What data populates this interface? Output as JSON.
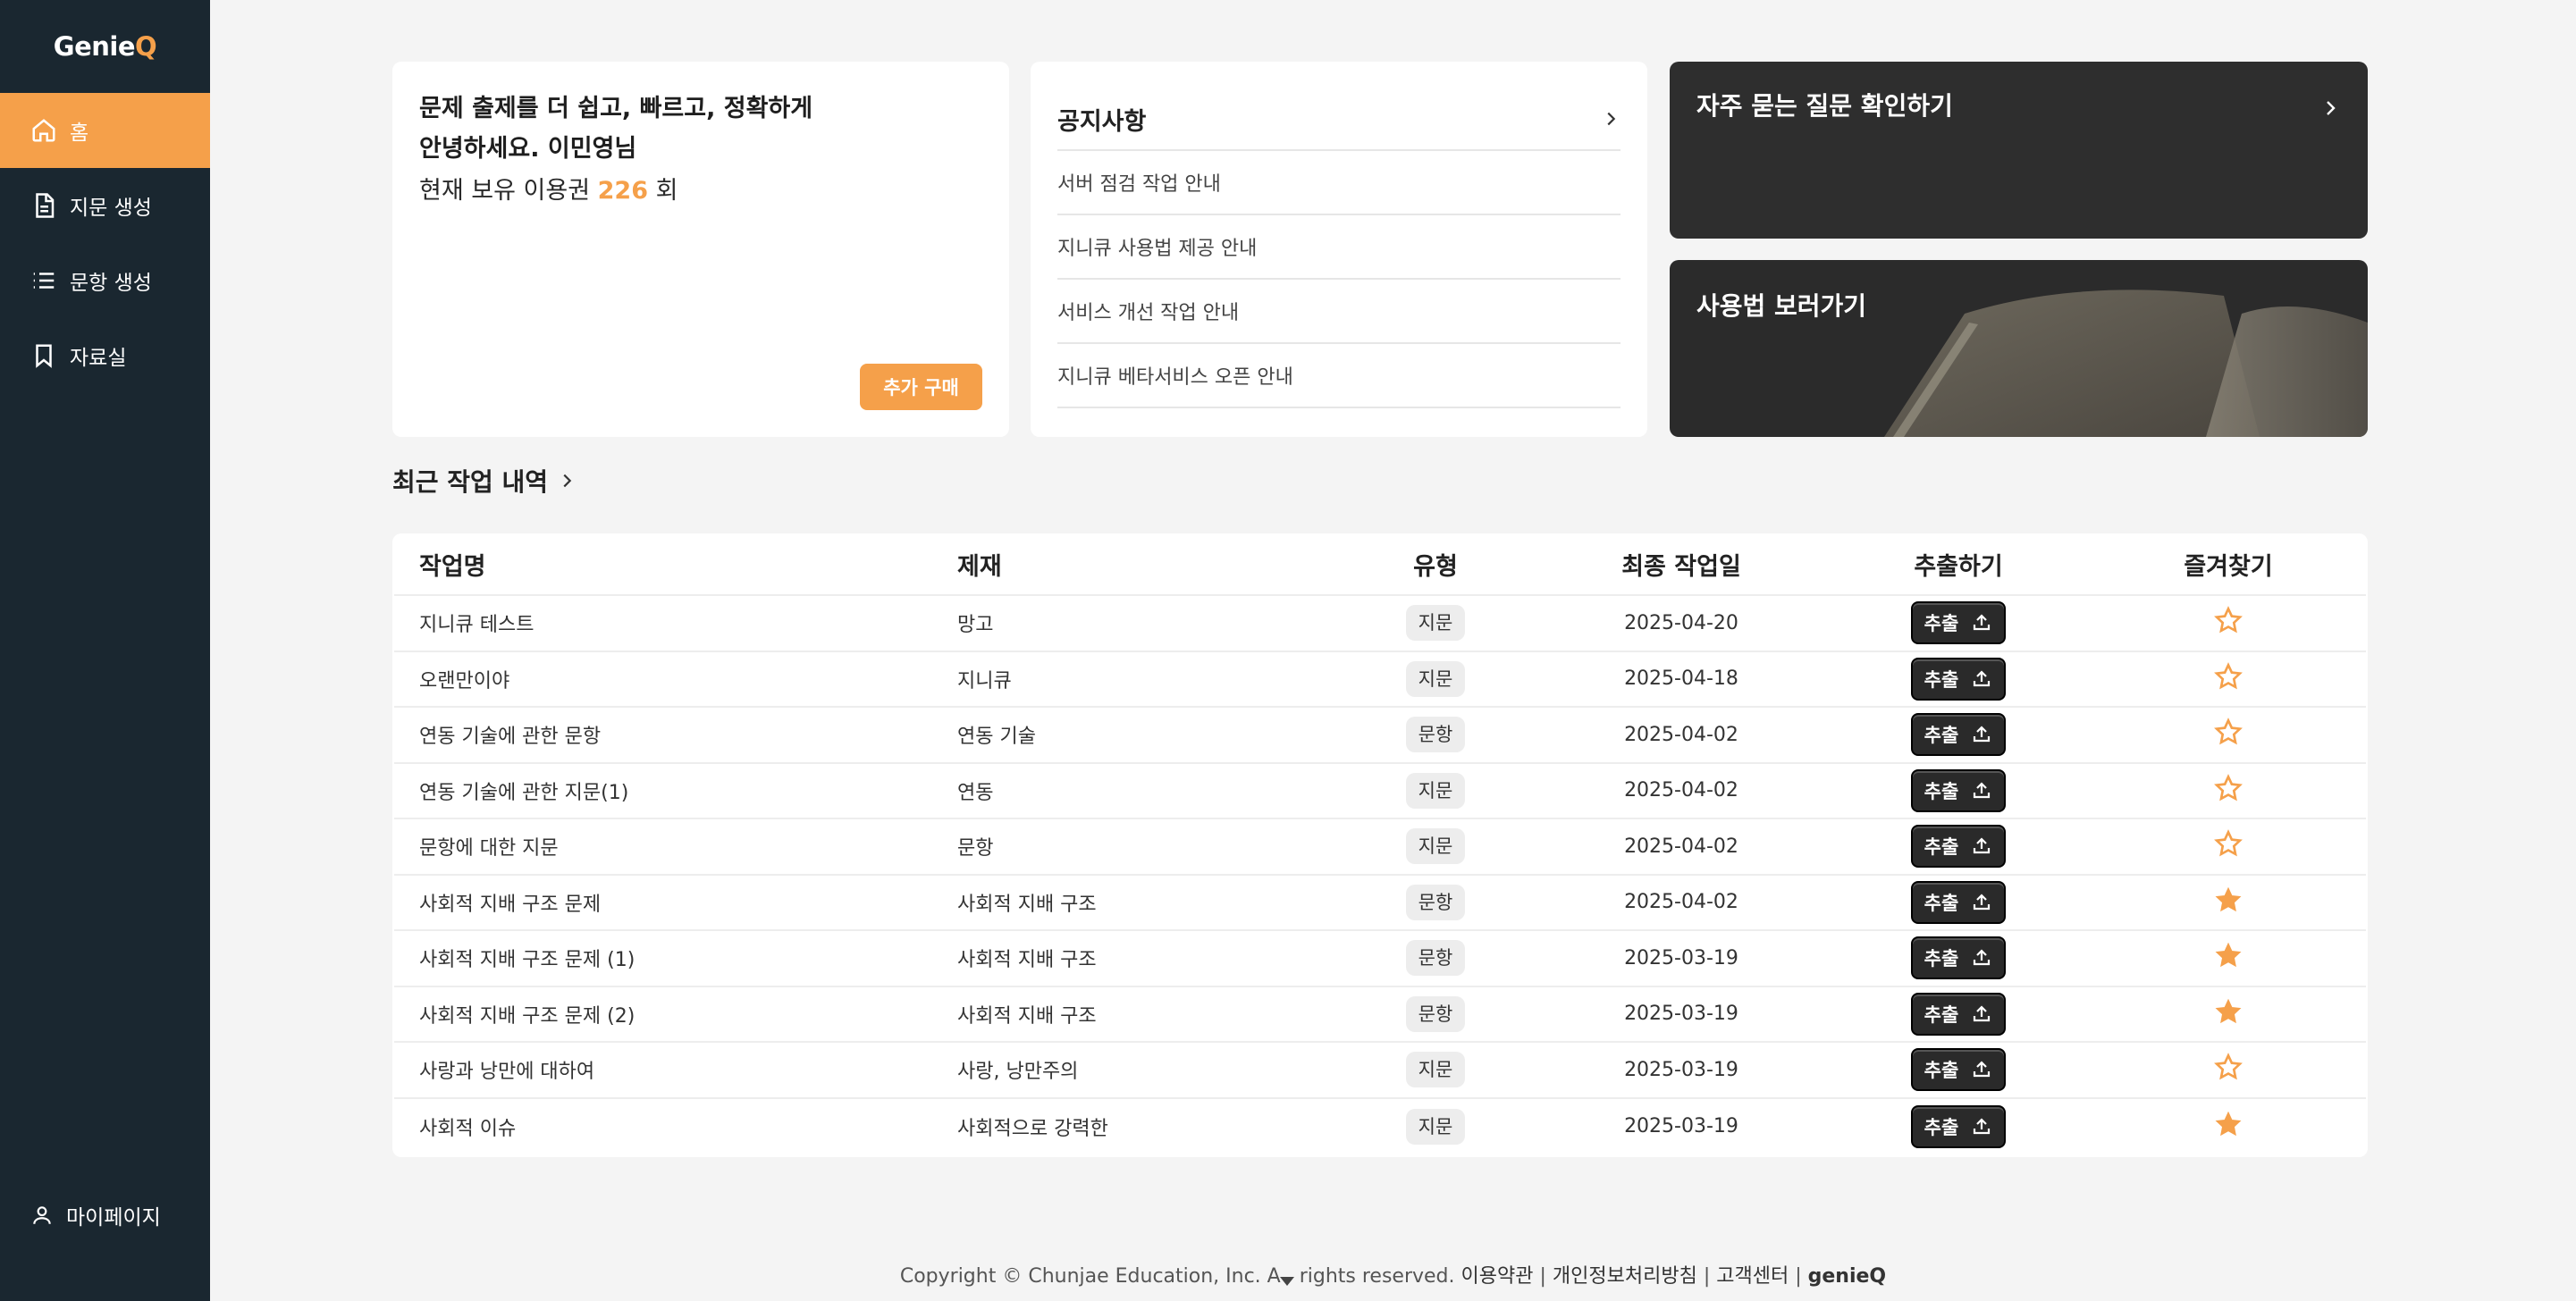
{
  "app": {
    "logo_text": "Genie",
    "logo_q": "Q"
  },
  "sidebar": {
    "items": [
      {
        "label": "홈",
        "icon": "home-icon"
      },
      {
        "label": "지문 생성",
        "icon": "document-icon"
      },
      {
        "label": "문항 생성",
        "icon": "list-icon"
      },
      {
        "label": "자료실",
        "icon": "bookmark-icon"
      }
    ],
    "mypage": "마이페이지"
  },
  "greeting": {
    "line1": "문제 출제를 더 쉽고, 빠르고, 정확하게",
    "line2": "안녕하세요. 이민영님",
    "tickets_prefix": "현재 보유 이용권",
    "tickets_count": "226",
    "tickets_suffix": "회",
    "buy_button": "추가 구매"
  },
  "notice": {
    "title": "공지사항",
    "items": [
      "서버 점검 작업 안내",
      "지니큐 사용법 제공 안내",
      "서비스 개선 작업 안내",
      "지니큐 베타서비스 오픈 안내"
    ]
  },
  "faq": {
    "title": "자주 묻는 질문 확인하기"
  },
  "usage": {
    "title": "사용법 보러가기"
  },
  "recent": {
    "title": "최근 작업 내역",
    "columns": [
      "작업명",
      "제재",
      "유형",
      "최종 작업일",
      "추출하기",
      "즐겨찾기"
    ],
    "export_label": "추출",
    "rows": [
      {
        "name": "지니큐 테스트",
        "subject": "망고",
        "type": "지문",
        "date": "2025-04-20",
        "favorite": false
      },
      {
        "name": "오랜만이야",
        "subject": "지니큐",
        "type": "지문",
        "date": "2025-04-18",
        "favorite": false
      },
      {
        "name": "연동 기술에 관한 문항",
        "subject": "연동 기술",
        "type": "문항",
        "date": "2025-04-02",
        "favorite": false
      },
      {
        "name": "연동 기술에 관한 지문(1)",
        "subject": "연동",
        "type": "지문",
        "date": "2025-04-02",
        "favorite": false
      },
      {
        "name": "문항에 대한 지문",
        "subject": "문항",
        "type": "지문",
        "date": "2025-04-02",
        "favorite": false
      },
      {
        "name": "사회적 지배 구조 문제",
        "subject": "사회적 지배 구조",
        "type": "문항",
        "date": "2025-04-02",
        "favorite": true
      },
      {
        "name": "사회적 지배 구조 문제 (1)",
        "subject": "사회적 지배 구조",
        "type": "문항",
        "date": "2025-03-19",
        "favorite": true
      },
      {
        "name": "사회적 지배 구조 문제 (2)",
        "subject": "사회적 지배 구조",
        "type": "문항",
        "date": "2025-03-19",
        "favorite": true
      },
      {
        "name": "사랑과 낭만에 대하여",
        "subject": "사랑, 낭만주의",
        "type": "지문",
        "date": "2025-03-19",
        "favorite": false
      },
      {
        "name": "사회적 이슈",
        "subject": "사회적으로 강력한",
        "type": "지문",
        "date": "2025-03-19",
        "favorite": true
      }
    ]
  },
  "footer": {
    "copyright": "Copyright © Chunjae Education, Inc. A",
    "copyright_tail": "rights reserved.",
    "terms": "이용약관",
    "privacy": "개인정보처리방침",
    "support": "고객센터",
    "sep": "|",
    "brand": "genieQ"
  },
  "colors": {
    "accent": "#f5a04a",
    "sidebar_bg": "#1a2730",
    "dark_card": "#2e2e2e"
  }
}
